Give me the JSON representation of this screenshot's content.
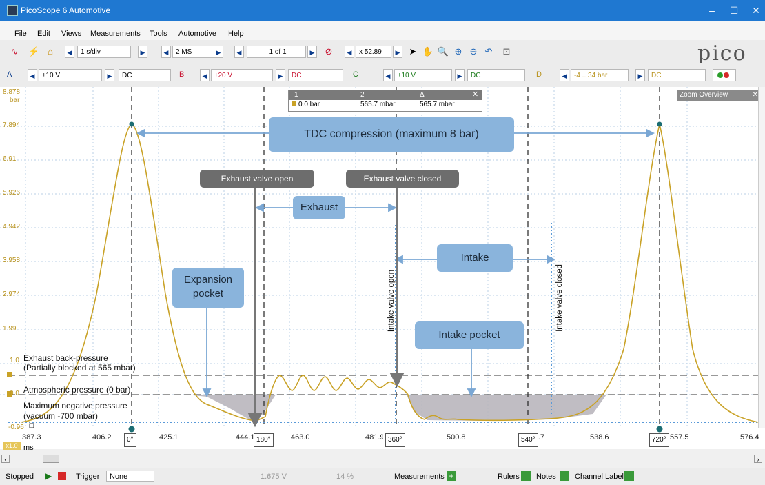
{
  "window": {
    "title": "PicoScope 6 Automotive",
    "controls": [
      "–",
      "☐",
      "✕"
    ]
  },
  "menu": [
    "File",
    "Edit",
    "Views",
    "Measurements",
    "Tools",
    "Automotive",
    "Help"
  ],
  "toolbar1": {
    "timebase": "1 s/div",
    "samples": "2 MS",
    "page": "1 of 1",
    "zoom": "x 52.89",
    "logo": "pico"
  },
  "channels": [
    {
      "name": "A",
      "range": "±10 V",
      "coupling": "DC"
    },
    {
      "name": "B",
      "range": "±20 V",
      "coupling": "DC"
    },
    {
      "name": "C",
      "range": "±10 V",
      "coupling": "DC"
    },
    {
      "name": "D",
      "range": "-4 .. 34 bar",
      "coupling": "DC"
    }
  ],
  "ruler_table": {
    "h1": "1",
    "h2": "2",
    "h3": "Δ",
    "v1": "0.0 bar",
    "v2": "565.7 mbar",
    "v3": "565.7 mbar"
  },
  "zoom_overview": "Zoom Overview",
  "y_axis": {
    "unit": "bar",
    "ticks": [
      "8.878",
      "7.894",
      "6.91",
      "5.926",
      "4.942",
      "3.958",
      "2.974",
      "1.99",
      "1.0",
      "0.0",
      "-0.96"
    ]
  },
  "x_axis": {
    "unit": "ms",
    "scale_label": "x1.0",
    "ticks": [
      "387.3",
      "406.2",
      "425.1",
      "444.1",
      "463.0",
      "481.9",
      "500.8",
      "519.7",
      "538.6",
      "557.5",
      "576.4"
    ]
  },
  "degree_markers": [
    "0°",
    "180°",
    "360°",
    "540°",
    "720°"
  ],
  "callouts": {
    "tdc": "TDC compression (maximum 8 bar)",
    "exhaust_open": "Exhaust valve open",
    "exhaust_closed": "Exhaust valve closed",
    "exhaust": "Exhaust",
    "intake": "Intake",
    "expansion": "Expansion pocket",
    "intake_pocket": "Intake pocket",
    "intake_open": "Intake valve open",
    "intake_closed": "Intake valve closed"
  },
  "annotations": {
    "back_pressure_1": "Exhaust back-pressure",
    "back_pressure_2": "(Partially blocked at 565 mbar)",
    "atmospheric": "Atmospheric pressure (0 bar)",
    "negative_1": "Maximum negative pressure",
    "negative_2": "(vacuum -700 mbar)"
  },
  "status": {
    "state": "Stopped",
    "trigger_label": "Trigger",
    "trigger_mode": "None",
    "threshold": "1.675 V",
    "pretrigger": "14 %",
    "measurements": "Measurements",
    "rulers": "Rulers",
    "notes": "Notes",
    "channel_labels": "Channel Labels"
  },
  "colors": {
    "trace": "#c9a227",
    "callout_blue": "#8ab4dc",
    "callout_gray": "#6d6d6d",
    "titlebar": "#1f78d1"
  }
}
